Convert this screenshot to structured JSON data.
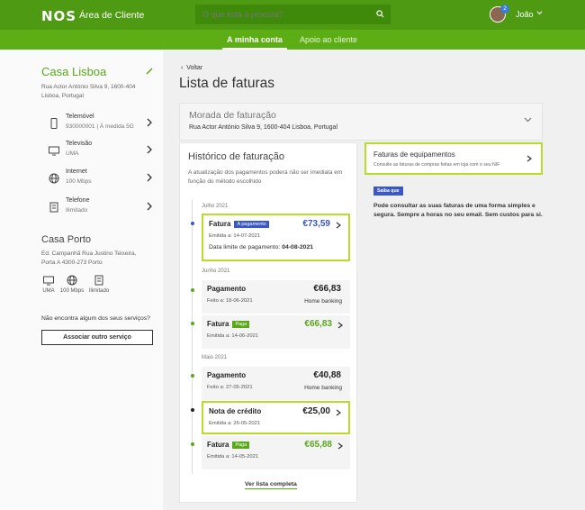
{
  "header": {
    "logo": "NOS",
    "app_title": "Área de Cliente",
    "search_placeholder": "O que está à procura?",
    "notification_count": "2",
    "user_name": "João"
  },
  "nav": {
    "tabs": [
      {
        "label": "A minha conta",
        "active": true
      },
      {
        "label": "Apoio ao cliente",
        "active": false
      }
    ]
  },
  "sidebar": {
    "home1": {
      "name": "Casa Lisboa",
      "address": "Rua Actor António Silva 9, 1600-404 Lisboa, Portugal",
      "services": [
        {
          "icon": "mobile-phone-icon",
          "name": "Telemóvel",
          "desc": "930000001 | À medida 5G"
        },
        {
          "icon": "tv-icon",
          "name": "Televisão",
          "desc": "UMA"
        },
        {
          "icon": "globe-icon",
          "name": "Internet",
          "desc": "100 Mbps"
        },
        {
          "icon": "landline-phone-icon",
          "name": "Telefone",
          "desc": "Ilimitado"
        }
      ]
    },
    "home2": {
      "name": "Casa Porto",
      "address": "Ed. Campanhã Rua Justino Teixeira, Porta A 4300-273 Porto",
      "services": [
        {
          "icon": "tv-icon",
          "label": "UMA"
        },
        {
          "icon": "globe-icon",
          "label": "100 Mbps"
        },
        {
          "icon": "landline-phone-icon",
          "label": "Ilimitado"
        }
      ]
    },
    "missing_service_text": "Não encontra algum dos seus serviços?",
    "associate_button": "Associar outro serviço"
  },
  "main": {
    "back_label": "Voltar",
    "title": "Lista de faturas",
    "billing_address_label": "Morada de faturação",
    "billing_address_value": "Rua Actor António Silva 9, 1600-404 Lisboa, Portugal",
    "history": {
      "title": "Histórico de faturação",
      "note": "A atualização dos pagamentos poderá não ser imediata em função do método escolhido",
      "months": [
        "Julho 2021",
        "Junho 2021",
        "Maio 2021"
      ],
      "items": [
        {
          "title": "Fatura",
          "tag": "A pagamento",
          "amount": "€73,59",
          "sub": "Emitida a: 14-07-2021",
          "extra_label": "Data limite de pagamento:",
          "extra_value": "04-08-2021"
        },
        {
          "title": "Pagamento",
          "amount": "€66,83",
          "sub": "Feito a: 18-06-2021",
          "right": "Home banking"
        },
        {
          "title": "Fatura",
          "tag": "Paga",
          "amount": "€66,83",
          "sub": "Emitida a: 14-06-2021"
        },
        {
          "title": "Pagamento",
          "amount": "€40,88",
          "sub": "Feito a: 27-05-2021",
          "right": "Home banking"
        },
        {
          "title": "Nota de crédito",
          "amount": "€25,00",
          "sub": "Emitida a: 26-05-2021"
        },
        {
          "title": "Fatura",
          "tag": "Paga",
          "amount": "€65,88",
          "sub": "Emitida a: 14-05-2021"
        }
      ],
      "see_all": "Ver lista completa"
    },
    "equipment": {
      "title": "Faturas de equipamentos",
      "subtitle": "Consulte as faturas de compras feitas em loja com o seu NIF"
    },
    "promo": {
      "pill": "Saiba que",
      "text": "Pode consultar as suas faturas de uma forma simples e segura. Sempre a horas no seu email. Sem custos para si."
    }
  },
  "colors": {
    "brand_green": "#4e9a12",
    "nav_green": "#5dae15",
    "highlight": "#b7dc2a",
    "accent_blue": "#3a57c8"
  }
}
